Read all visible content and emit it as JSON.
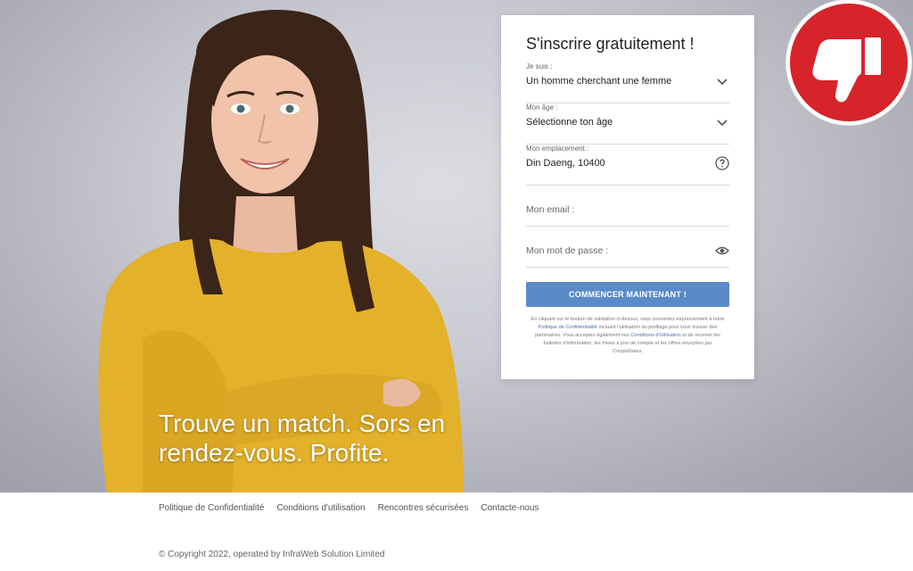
{
  "hero": {
    "tagline_line1": "Trouve un match. Sors en",
    "tagline_line2": "rendez-vous. Profite."
  },
  "form": {
    "title": "S'inscrire gratuitement !",
    "fields": [
      {
        "label": "Je suis :",
        "value": "Un homme cherchant une femme",
        "icon": "chevron-down-icon"
      },
      {
        "label": "Mon âge :",
        "value": "Sélectionne ton âge",
        "icon": "chevron-down-icon"
      },
      {
        "label": "Mon emplacement :",
        "value": "Din Daeng, 10400",
        "icon": "help-icon"
      },
      {
        "placeholder": "Mon email :"
      },
      {
        "placeholder": "Mon mot de passe :",
        "icon": "eye-icon"
      }
    ],
    "cta_label": "COMMENCER MAINTENANT !",
    "legal": {
      "part1": "En cliquant sur le bouton de validation ci-dessus, vous consentez expressément à notre ",
      "link1": "Politique de Confidentialité",
      "part2": " incluant l'utilisation du profilage pour vous trouver des partenaires. Vous acceptez également nos ",
      "link2": "Conditions d'Utilisation",
      "part3": " et de recevoir les bulletins d'information, les mises à jour de compte et les offres envoyées par CoupleDates."
    }
  },
  "badge": {
    "icon": "thumbs-down-icon",
    "color": "#d7232a"
  },
  "footer": {
    "links": [
      "Politique de Confidentialité",
      "Conditions d'utilisation",
      "Rencontres sécurisées",
      "Contacte-nous"
    ],
    "copyright": "© Copyright 2022, operated by InfraWeb Solution Limited"
  },
  "colors": {
    "accent": "#5b8ac8",
    "badge": "#d7232a",
    "shirt": "#e3b12a"
  }
}
